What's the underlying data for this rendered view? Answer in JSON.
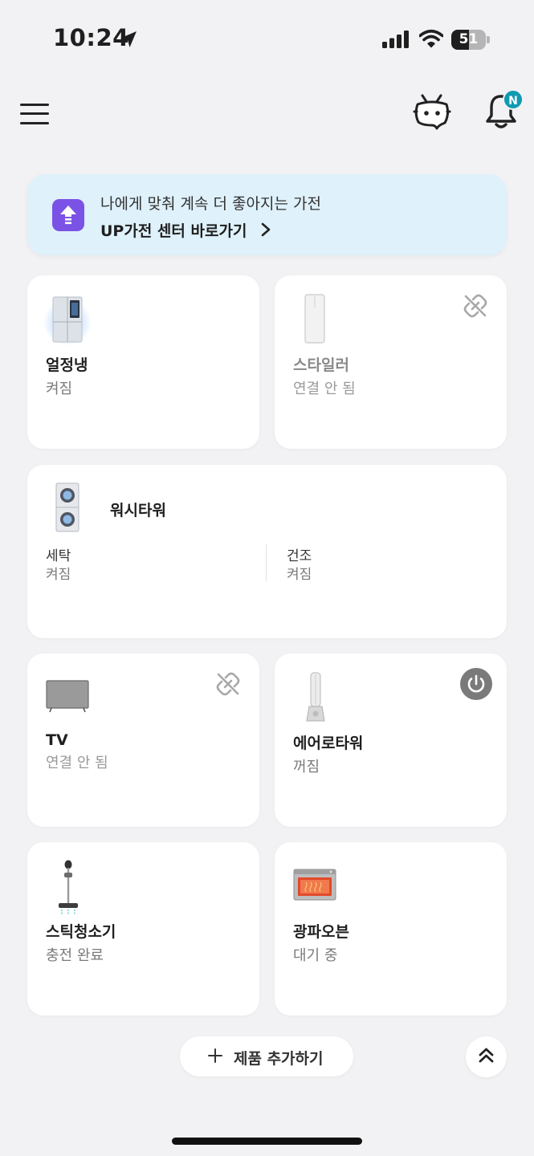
{
  "status_bar": {
    "time": "10:24",
    "battery_percent": 51,
    "battery_label": "51",
    "icons": [
      "location-arrow-icon",
      "signal-bars-icon",
      "wifi-icon",
      "battery-icon"
    ]
  },
  "header": {
    "icons": [
      "hamburger-menu-icon",
      "chatbot-icon",
      "bell-icon"
    ],
    "notification_badge": "N",
    "badge_color": "#0f9ab2"
  },
  "banner": {
    "line1": "나에게 맞춰 계속 더 좋아지는 가전",
    "line2": "UP가전 센터 바로가기",
    "icon": "upgrade-arrow-icon",
    "background": "#dff1fa",
    "icon_color": "#7b52e6"
  },
  "devices": {
    "fridge": {
      "name": "얼정냉",
      "status": "켜짐",
      "icon": "refrigerator-icon"
    },
    "styler": {
      "name": "스타일러",
      "status": "연결 안 됨",
      "icon": "styler-icon",
      "badge_icon": "link-off-icon"
    },
    "washtower": {
      "name": "워시타워",
      "icon": "washtower-icon",
      "wash": {
        "label": "세탁",
        "status": "켜짐"
      },
      "dry": {
        "label": "건조",
        "status": "켜짐"
      }
    },
    "tv": {
      "name": "TV",
      "status": "연결 안 됨",
      "icon": "tv-icon",
      "badge_icon": "link-off-icon"
    },
    "aerotower": {
      "name": "에어로타워",
      "status": "꺼짐",
      "icon": "aerotower-icon",
      "badge_icon": "power-icon"
    },
    "vacuum": {
      "name": "스틱청소기",
      "status": "충전 완료",
      "icon": "stick-vacuum-icon"
    },
    "oven": {
      "name": "광파오븐",
      "status": "대기 중",
      "icon": "oven-icon"
    }
  },
  "footer": {
    "add_label": "제품 추가하기",
    "icons": [
      "plus-icon",
      "scroll-top-icon"
    ]
  }
}
